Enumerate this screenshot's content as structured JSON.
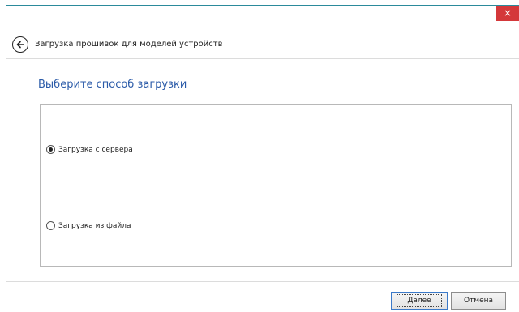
{
  "window": {
    "close_glyph": "×",
    "accent_color": "#2b8a9b",
    "close_color": "#d4383a"
  },
  "header": {
    "title": "Загрузка прошивок для моделей устройств",
    "back_icon": "arrow-left-circle-icon"
  },
  "content": {
    "section_title": "Выберите способ загрузки",
    "title_color": "#2a5aa8",
    "options": [
      {
        "label": "Загрузка с сервера",
        "selected": true
      },
      {
        "label": "Загрузка из файла",
        "selected": false
      }
    ]
  },
  "footer": {
    "next_label": "Далее",
    "cancel_label": "Отмена"
  }
}
